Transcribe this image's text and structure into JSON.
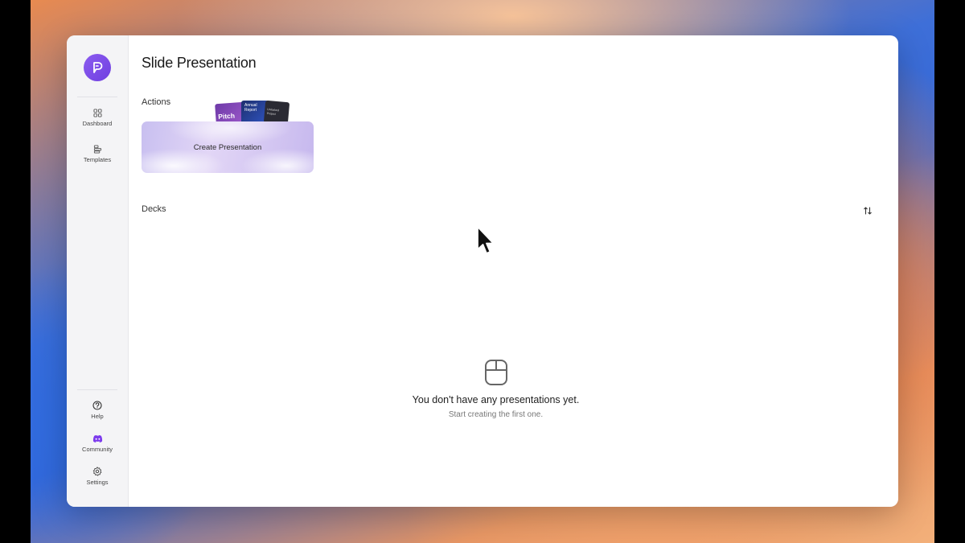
{
  "app": {
    "title": "Slide Presentation"
  },
  "sidebar": {
    "top_items": [
      {
        "label": "Dashboard",
        "icon": "grid-icon"
      },
      {
        "label": "Templates",
        "icon": "templates-icon"
      }
    ],
    "bottom_items": [
      {
        "label": "Help",
        "icon": "help-icon"
      },
      {
        "label": "Community",
        "icon": "discord-icon"
      },
      {
        "label": "Settings",
        "icon": "gear-icon"
      }
    ]
  },
  "actions": {
    "section_label": "Actions",
    "create_label": "Create Presentation",
    "deck_thumbnails": [
      "Pitch",
      "Annual Report",
      "Unlocked Project"
    ]
  },
  "decks": {
    "section_label": "Decks",
    "sort_icon": "sort-arrows-icon"
  },
  "empty_state": {
    "icon": "mouse-icon",
    "title": "You don't have any presentations yet.",
    "subtitle": "Start creating the first one."
  },
  "colors": {
    "accent": "#7b4bea",
    "community_icon": "#7c3aed",
    "window_bg": "#ffffff",
    "sidebar_bg": "#f4f4f6"
  }
}
